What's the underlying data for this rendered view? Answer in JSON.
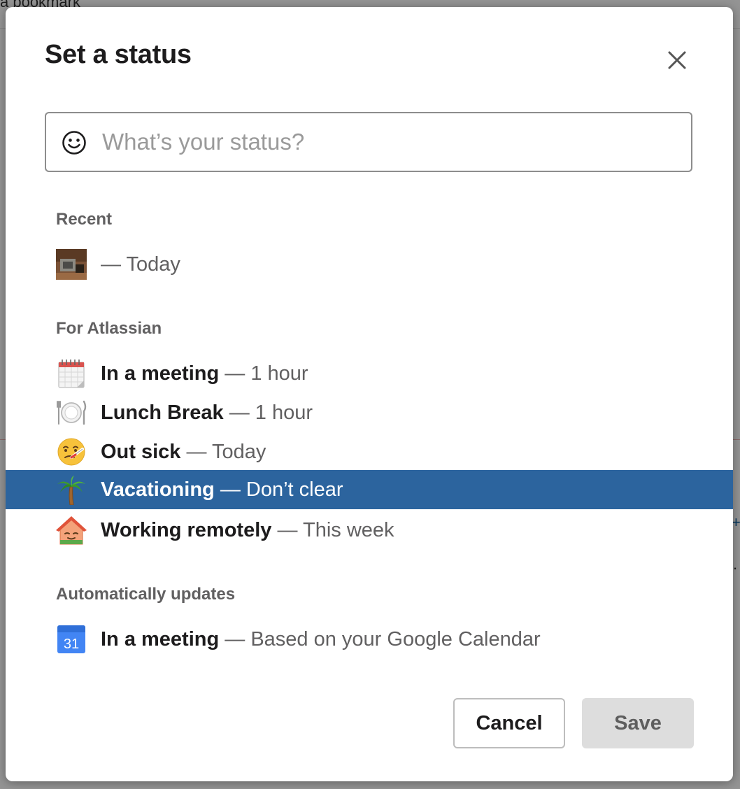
{
  "background": {
    "peek_text": "a bookmark"
  },
  "modal": {
    "title": "Set a status",
    "close_icon": "close-icon",
    "search": {
      "placeholder": "What’s your status?",
      "value": "",
      "icon": "smiley-icon"
    },
    "sections": {
      "recent": {
        "header": "Recent",
        "items": [
          {
            "title": "",
            "separator": "—",
            "duration": "Today",
            "icon": "custom-photo-emoji-icon"
          }
        ]
      },
      "for_workspace": {
        "header": "For Atlassian",
        "items": [
          {
            "title": "In a meeting",
            "separator": "—",
            "duration": "1 hour",
            "icon": "spiral-calendar-icon"
          },
          {
            "title": "Lunch Break",
            "separator": "—",
            "duration": "1 hour",
            "icon": "plate-with-cutlery-icon"
          },
          {
            "title": "Out sick",
            "separator": "—",
            "duration": "Today",
            "icon": "thermometer-face-icon"
          },
          {
            "title": "Vacationing",
            "separator": "—",
            "duration": "Don’t clear",
            "icon": "palm-tree-icon",
            "selected": true
          },
          {
            "title": "Working remotely",
            "separator": "—",
            "duration": "This week",
            "icon": "house-with-face-icon"
          }
        ]
      },
      "auto_updates": {
        "header": "Automatically updates",
        "items": [
          {
            "title": "In a meeting",
            "separator": "—",
            "duration": "Based on your Google Calendar",
            "icon": "google-calendar-icon",
            "calendar_day": "31"
          }
        ]
      }
    },
    "buttons": {
      "cancel": "Cancel",
      "save": "Save"
    },
    "colors": {
      "selected_row": "#2c649e",
      "save_disabled_bg": "#dddddd",
      "input_border": "#8d8d8d"
    }
  }
}
